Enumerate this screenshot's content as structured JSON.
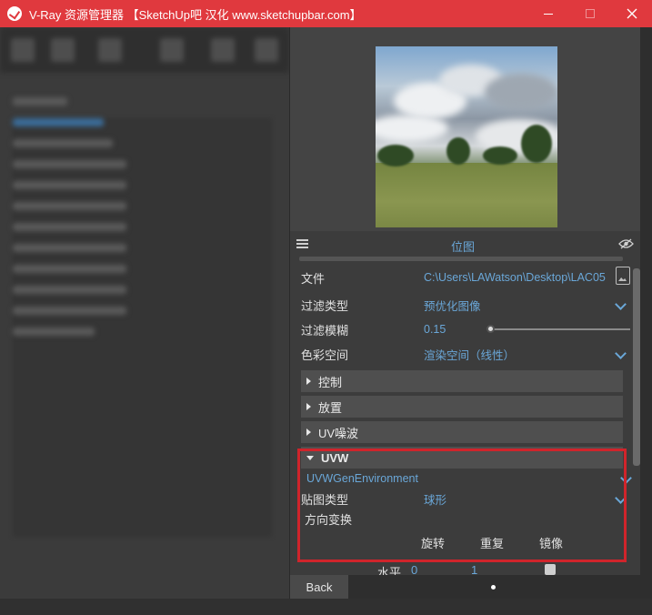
{
  "window": {
    "title": "V-Ray 资源管理器 【SketchUp吧 汉化 www.sketchupbar.com】",
    "minimize": "minimize",
    "maximize": "maximize",
    "close": "close"
  },
  "editor": {
    "section_title": "位图",
    "properties": {
      "file": {
        "label": "文件",
        "value": "C:\\Users\\LAWatson\\Desktop\\LAC05..."
      },
      "filter_type": {
        "label": "过滤类型",
        "value": "预优化图像"
      },
      "filter_blur": {
        "label": "过滤模糊",
        "value": "0.15"
      },
      "color_space": {
        "label": "色彩空间",
        "value": "渲染空间（线性）"
      }
    },
    "rollouts": {
      "control": "控制",
      "placement": "放置",
      "uv_noise": "UV噪波",
      "uvw": "UVW"
    },
    "uvw": {
      "generator": "UVWGenEnvironment",
      "map_type_label": "贴图类型",
      "map_type_value": "球形",
      "direction_label": "方向变换",
      "rotate": "旋转",
      "reset": "重复",
      "mirror": "镜像"
    },
    "horizontal": {
      "label": "水平",
      "v0": "0",
      "v1": "1"
    },
    "back": "Back"
  },
  "colors": {
    "titlebar": "#e0393e",
    "accent_blue": "#6aa7d8",
    "highlight_red": "#d0242b"
  }
}
